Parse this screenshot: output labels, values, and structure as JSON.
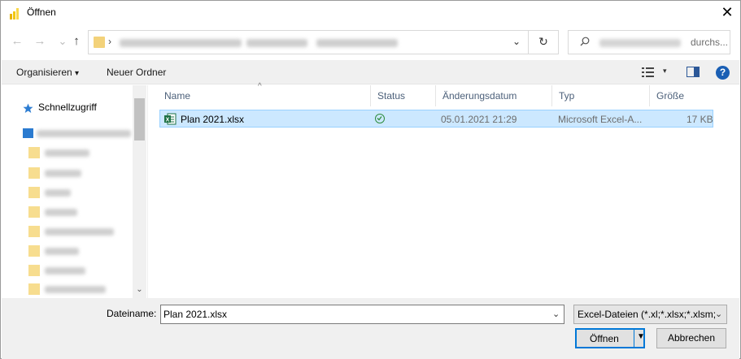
{
  "window": {
    "title": "Öffnen",
    "close_glyph": "✕"
  },
  "nav": {
    "back_glyph": "←",
    "forward_glyph": "→",
    "up_glyph": "↑",
    "address_chevron": "›",
    "address_dropdown": "⌄",
    "refresh_glyph": "↻"
  },
  "search": {
    "placeholder_suffix": "durchs..."
  },
  "toolbar": {
    "organize_label": "Organisieren",
    "organize_arrow": "▾",
    "new_folder_label": "Neuer Ordner",
    "view_arrow": "▾",
    "help_glyph": "?"
  },
  "sidebar": {
    "quick_access_label": "Schnellzugriff"
  },
  "columns": {
    "name": "Name",
    "status": "Status",
    "date": "Änderungsdatum",
    "type": "Typ",
    "size": "Größe"
  },
  "files": [
    {
      "name": "Plan 2021.xlsx",
      "date": "05.01.2021 21:29",
      "type": "Microsoft Excel-A...",
      "size": "17 KB"
    }
  ],
  "footer": {
    "filename_label": "Dateiname:",
    "filename_value": "Plan 2021.xlsx",
    "filter_value": "Excel-Dateien (*.xl;*.xlsx;*.xlsm;",
    "open_label": "Öffnen",
    "cancel_label": "Abbrechen"
  },
  "colors": {
    "selection": "#cce8ff",
    "accent": "#0078d7",
    "excel_green": "#1e7145",
    "status_green": "#2d8c3c"
  }
}
